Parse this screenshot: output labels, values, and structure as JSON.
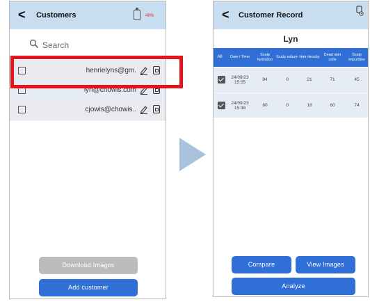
{
  "left": {
    "back_glyph": "<",
    "title": "Customers",
    "battery_pct": "40%",
    "search_placeholder": "Search",
    "customers": [
      {
        "email": "henrielyns@gm.",
        "checked": false
      },
      {
        "email": "lyn@chowis.com",
        "checked": false
      },
      {
        "email": "cjowis@chowis..",
        "checked": false
      }
    ],
    "download_label": "Download Images",
    "add_label": "Add customer"
  },
  "right": {
    "back_glyph": "<",
    "title": "Customer Record",
    "customer_name": "Lyn",
    "columns": [
      "All",
      "Date / Time",
      "Scalp hydration",
      "Scalp sebum",
      "Hair density",
      "Dead skin cells",
      "Scalp impurities"
    ],
    "rows": [
      {
        "date": "24/09/23",
        "time": "15:55",
        "values": [
          "94",
          "0",
          "21",
          "71",
          "45"
        ],
        "checked": true
      },
      {
        "date": "24/09/23",
        "time": "15:38",
        "values": [
          "80",
          "0",
          "18",
          "60",
          "74"
        ],
        "checked": true
      }
    ],
    "compare_label": "Compare",
    "view_label": "View Images",
    "analyze_label": "Analyze"
  },
  "colors": {
    "header_bg": "#c9ddf0",
    "row_alt_bg": "#e6ecf5",
    "accent_blue": "#2f6fd6",
    "disabled_grey": "#bcbcbc",
    "highlight_red": "#e3141c",
    "battery_red": "#e0271f",
    "arrow": "#a9c1dc"
  },
  "icons": [
    "back-chevron-icon",
    "battery-icon",
    "search-icon",
    "edit-pencil-icon",
    "delete-icon",
    "settings-gear-icon",
    "checkbox-checked-icon",
    "arrow-right-icon"
  ]
}
